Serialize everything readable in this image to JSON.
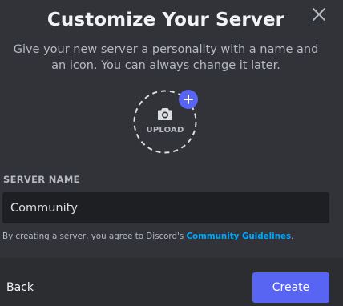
{
  "modal": {
    "title": "Customize Your Server",
    "subtitle": "Give your new server a personality with a name and an icon. You can always change it later.",
    "close_icon": "close-icon"
  },
  "upload": {
    "label": "UPLOAD",
    "camera_icon": "camera-icon",
    "plus_icon": "plus-icon"
  },
  "server_name": {
    "label": "SERVER NAME",
    "value": "Community"
  },
  "terms": {
    "prefix": "By creating a server, you agree to Discord's ",
    "link": "Community Guidelines",
    "suffix": "."
  },
  "footer": {
    "back_label": "Back",
    "create_label": "Create"
  },
  "colors": {
    "background": "#313338",
    "footer": "#2b2d31",
    "accent": "#5865f2",
    "link": "#00a8fc",
    "input_bg": "#1e1f22"
  }
}
